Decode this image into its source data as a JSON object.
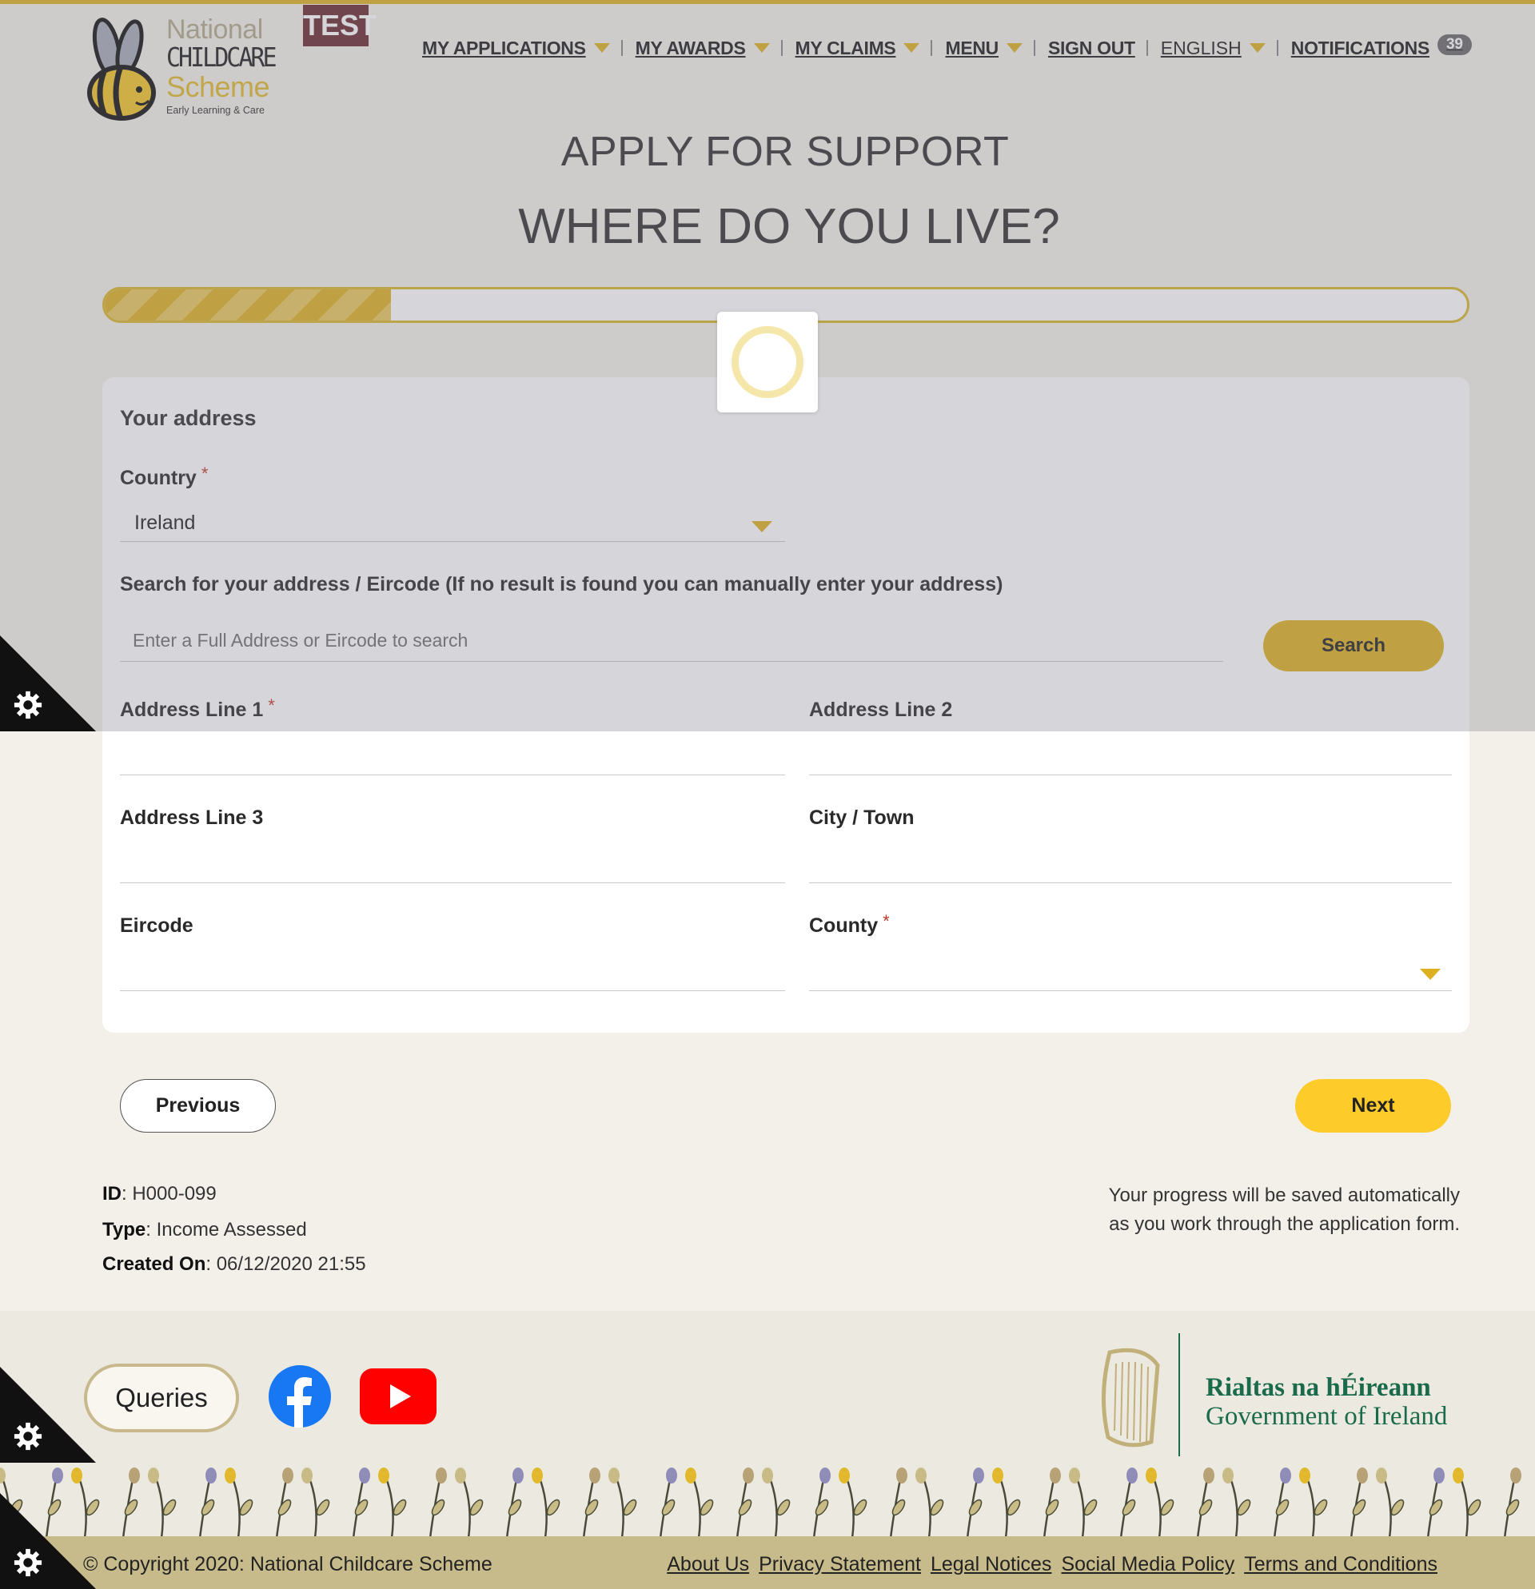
{
  "header": {
    "logo": {
      "national": "National",
      "childcare": "CHILDCARE",
      "scheme": "Scheme",
      "tagline": "Early Learning & Care"
    },
    "env_badge": "TEST",
    "nav": {
      "my_applications": "MY APPLICATIONS",
      "my_awards": "MY AWARDS",
      "my_claims": "MY CLAIMS",
      "menu": "MENU",
      "sign_out": "SIGN OUT",
      "language": "ENGLISH",
      "notifications": "NOTIFICATIONS",
      "notifications_count": "39"
    }
  },
  "page": {
    "title": "APPLY FOR SUPPORT",
    "subtitle": "WHERE DO YOU LIVE?",
    "progress_percent": 21
  },
  "form": {
    "section_title": "Your address",
    "country": {
      "label": "Country",
      "required_mark": "*",
      "value": "Ireland"
    },
    "search": {
      "label": "Search for your address / Eircode (If no result is found you can manually enter your address)",
      "placeholder": "Enter a Full Address or Eircode to search",
      "button": "Search"
    },
    "address_line_1": {
      "label": "Address Line 1",
      "required_mark": "*",
      "value": ""
    },
    "address_line_2": {
      "label": "Address Line 2",
      "value": ""
    },
    "address_line_3": {
      "label": "Address Line 3",
      "value": ""
    },
    "city_town": {
      "label": "City / Town",
      "value": ""
    },
    "eircode": {
      "label": "Eircode",
      "value": ""
    },
    "county": {
      "label": "County",
      "required_mark": "*",
      "value": ""
    }
  },
  "actions": {
    "previous": "Previous",
    "next": "Next"
  },
  "application_meta": {
    "id_label": "ID",
    "id_value": ": H000-099",
    "type_label": "Type",
    "type_value": ": Income Assessed",
    "created_label": "Created On",
    "created_value": ": 06/12/2020 21:55",
    "save_note_line1": "Your progress will be saved automatically",
    "save_note_line2": "as you work through the application form."
  },
  "footer": {
    "queries_button": "Queries",
    "social": [
      "facebook-icon",
      "youtube-icon"
    ],
    "gov_irish": "Rialtas na hÉireann",
    "gov_english": "Government of Ireland",
    "copyright": "© Copyright 2020: National Childcare Scheme",
    "links": [
      "About Us",
      "Privacy Statement",
      "Legal Notices",
      "Social Media Policy",
      "Terms and Conditions"
    ]
  },
  "colors": {
    "accent_gold": "#ddb01f",
    "next_yellow": "#fdcc2a",
    "test_badge": "#6a2a32",
    "gov_green": "#1a6a4c",
    "footer_bar": "#c8bb8b"
  }
}
